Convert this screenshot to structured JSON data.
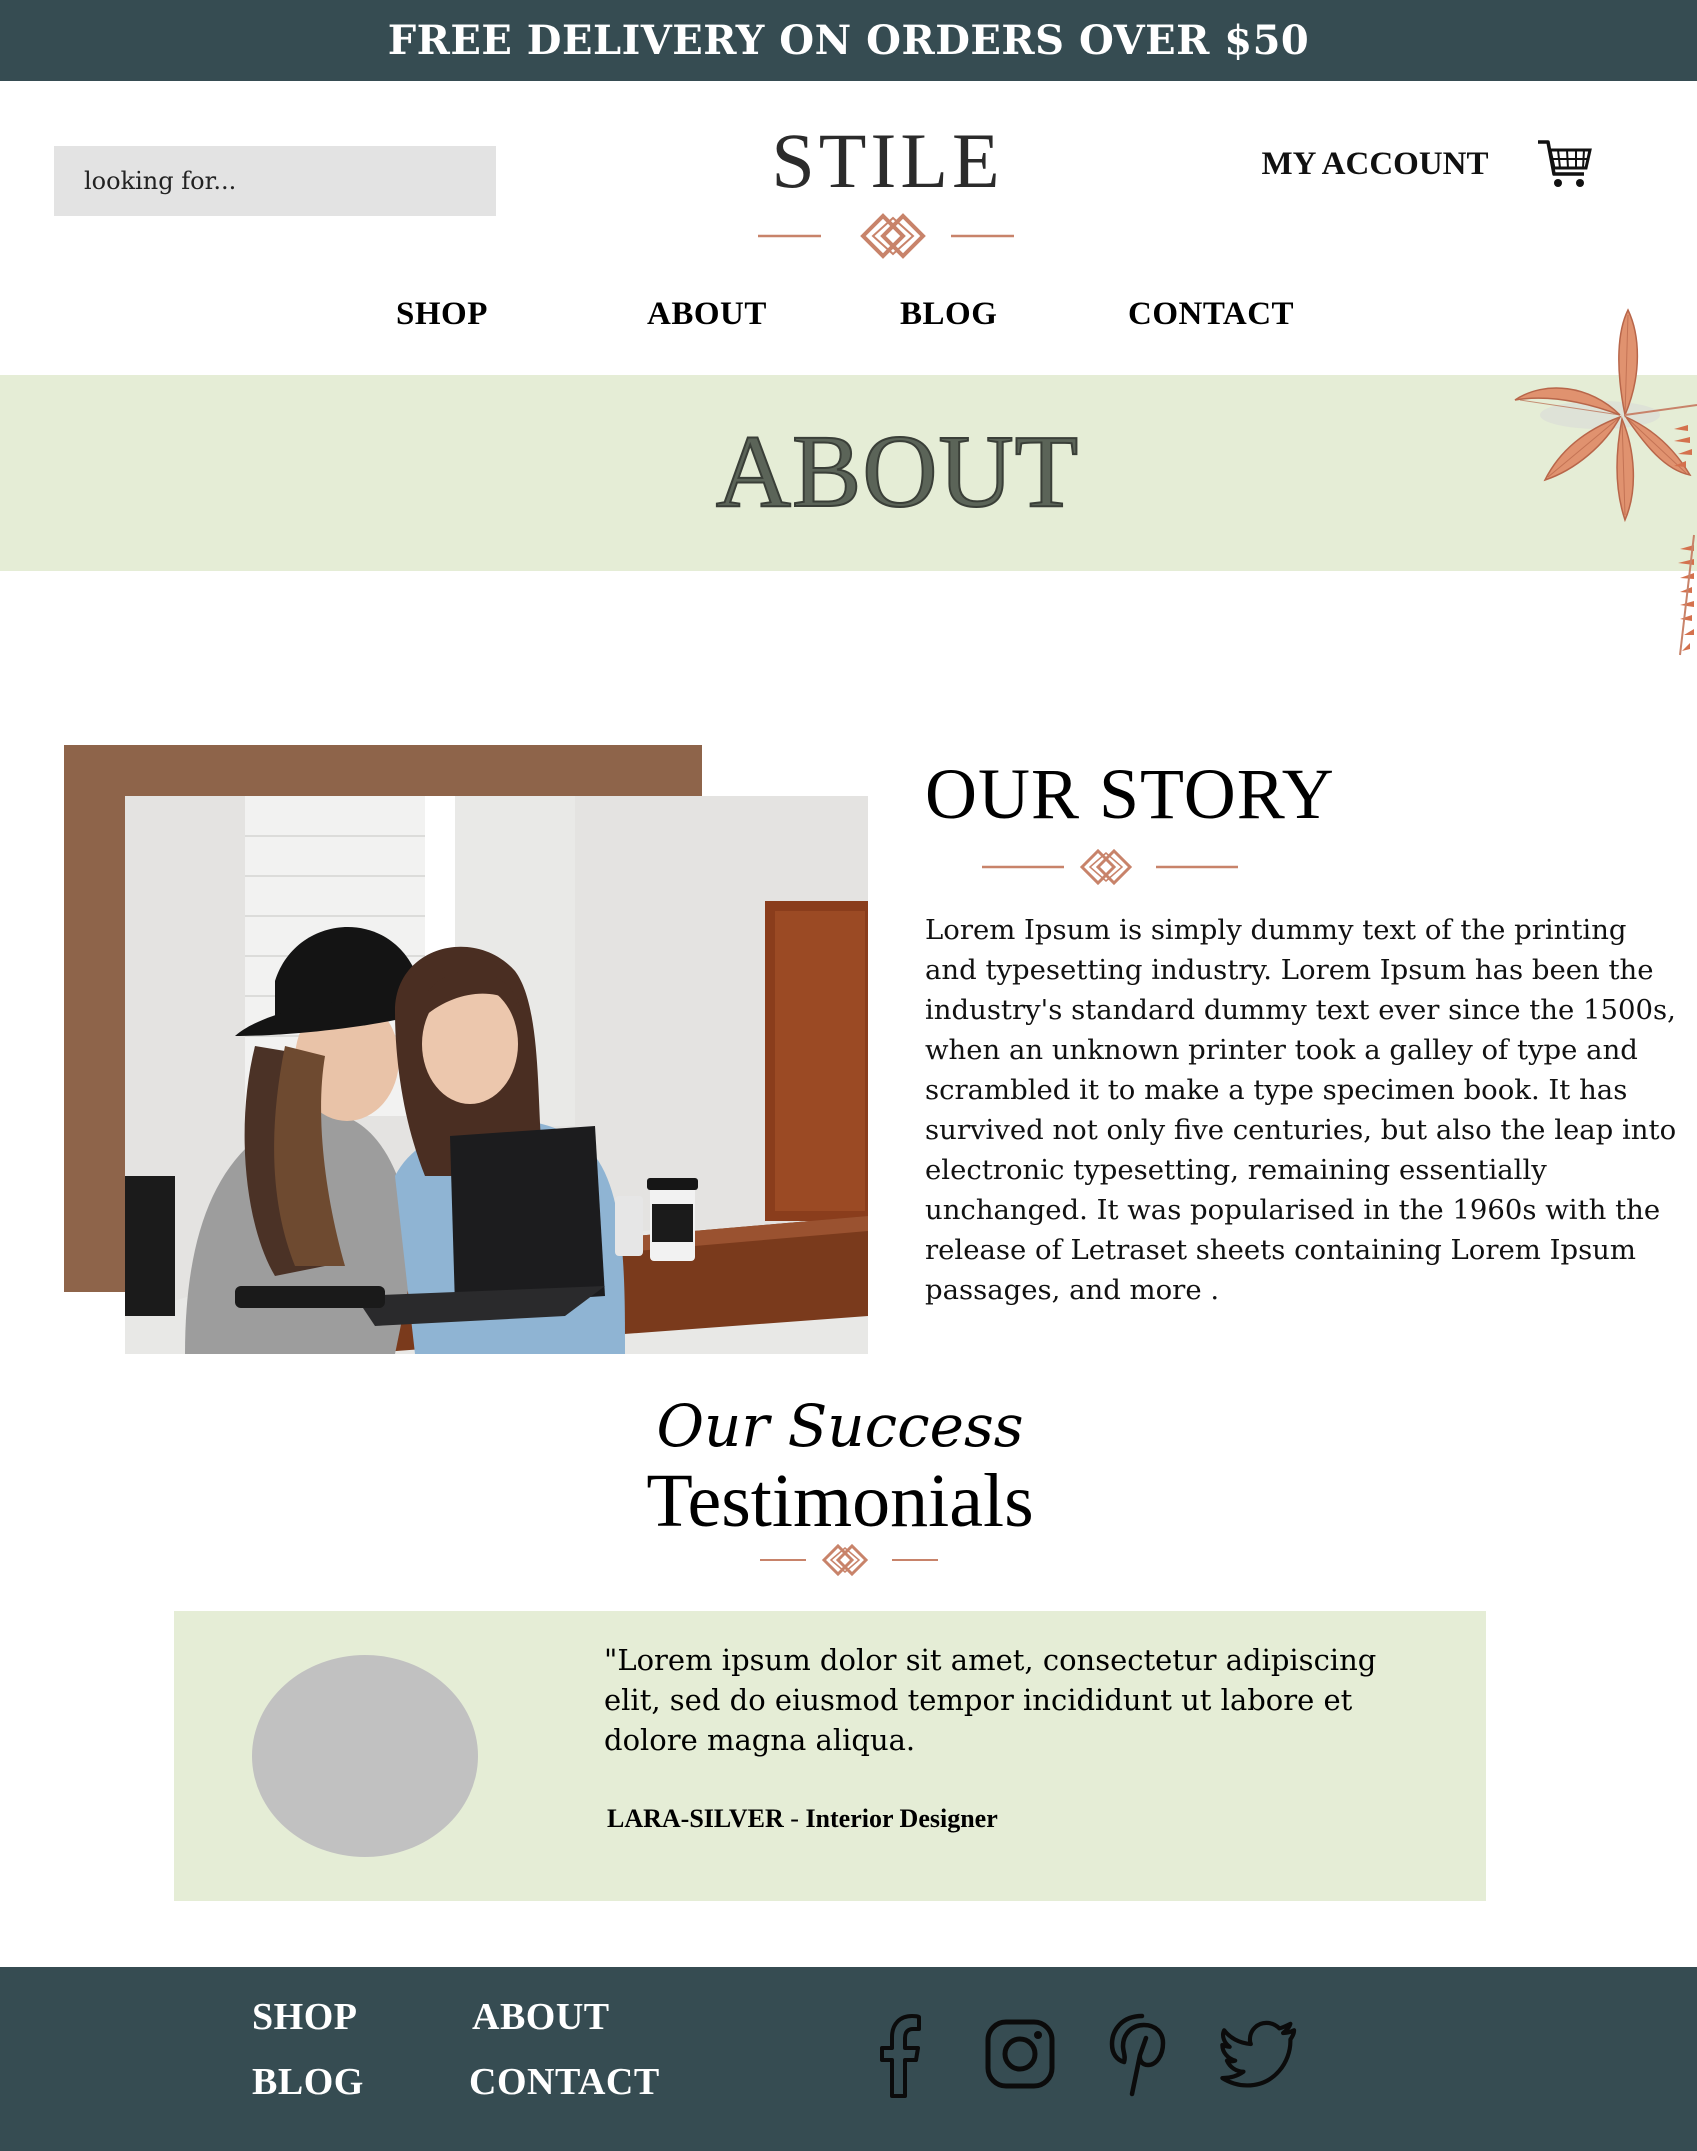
{
  "banner": {
    "text": "FREE DELIVERY ON ORDERS OVER $50"
  },
  "header": {
    "search_placeholder": "looking for...",
    "logo": "STILE",
    "account_label": "MY ACCOUNT",
    "cart_icon": "shopping-cart-icon"
  },
  "nav": {
    "items": [
      {
        "label": "SHOP"
      },
      {
        "label": "ABOUT"
      },
      {
        "label": "BLOG"
      },
      {
        "label": "CONTACT"
      }
    ]
  },
  "hero": {
    "title": "ABOUT"
  },
  "story": {
    "title": "OUR STORY",
    "text": "Lorem Ipsum is simply dummy text of the printing and typesetting industry. Lorem Ipsum has been the industry's standard dummy text ever since the 1500s, when an unknown printer took a galley of type and scrambled it to make a type specimen book. It has survived not only five centuries, but also the leap into electronic typesetting, remaining essentially unchanged. It was popularised in the 1960s with the release of Letraset sheets containing Lorem Ipsum passages, and more ."
  },
  "testimonials": {
    "script_heading": "Our Success",
    "title": "Testimonials",
    "quote": "\"Lorem ipsum dolor sit amet, consectetur adipiscing elit, sed do eiusmod tempor incididunt ut labore et dolore magna aliqua.",
    "author_name": "LARA-SILVER",
    "author_separator": " - ",
    "author_role": "Interior Designer"
  },
  "footer": {
    "links": [
      {
        "label": "SHOP"
      },
      {
        "label": "ABOUT"
      },
      {
        "label": "BLOG"
      },
      {
        "label": "CONTACT"
      }
    ],
    "social": [
      "facebook-icon",
      "instagram-icon",
      "pinterest-icon",
      "twitter-icon"
    ]
  },
  "colors": {
    "dark_teal": "#364c52",
    "sage": "#e5edd6",
    "terracotta": "#c8836a",
    "brown": "#8e644a"
  }
}
